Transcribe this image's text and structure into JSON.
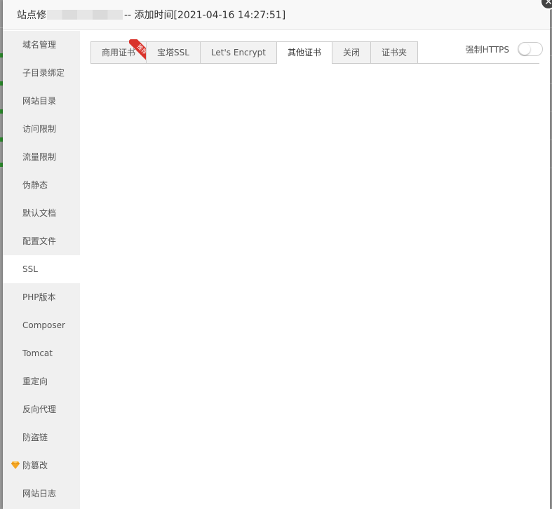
{
  "dialog": {
    "title_prefix": "站点修",
    "title_suffix": "-- 添加时间[2021-04-16 14:27:51]",
    "close_glyph": "✕"
  },
  "sidebar": {
    "items": [
      {
        "label": "域名管理"
      },
      {
        "label": "子目录绑定"
      },
      {
        "label": "网站目录"
      },
      {
        "label": "访问限制"
      },
      {
        "label": "流量限制"
      },
      {
        "label": "伪静态"
      },
      {
        "label": "默认文档"
      },
      {
        "label": "配置文件"
      },
      {
        "label": "SSL",
        "active": true
      },
      {
        "label": "PHP版本"
      },
      {
        "label": "Composer"
      },
      {
        "label": "Tomcat"
      },
      {
        "label": "重定向"
      },
      {
        "label": "反向代理"
      },
      {
        "label": "防盗链"
      },
      {
        "label": "防篡改",
        "icon": "gem-icon",
        "icon_color": "#f5a623"
      },
      {
        "label": "网站日志"
      }
    ]
  },
  "ssl": {
    "tabs": [
      {
        "label": "商用证书",
        "badge": "推荐"
      },
      {
        "label": "宝塔SSL"
      },
      {
        "label": "Let's Encrypt"
      },
      {
        "label": "其他证书",
        "active": true
      },
      {
        "label": "关闭"
      },
      {
        "label": "证书夹"
      }
    ],
    "force_https_label": "强制HTTPS",
    "force_https_on": false
  },
  "colors": {
    "badge": "#d9332b",
    "sidebar_bg": "#f0f0f0",
    "gem": "#f5a623"
  }
}
